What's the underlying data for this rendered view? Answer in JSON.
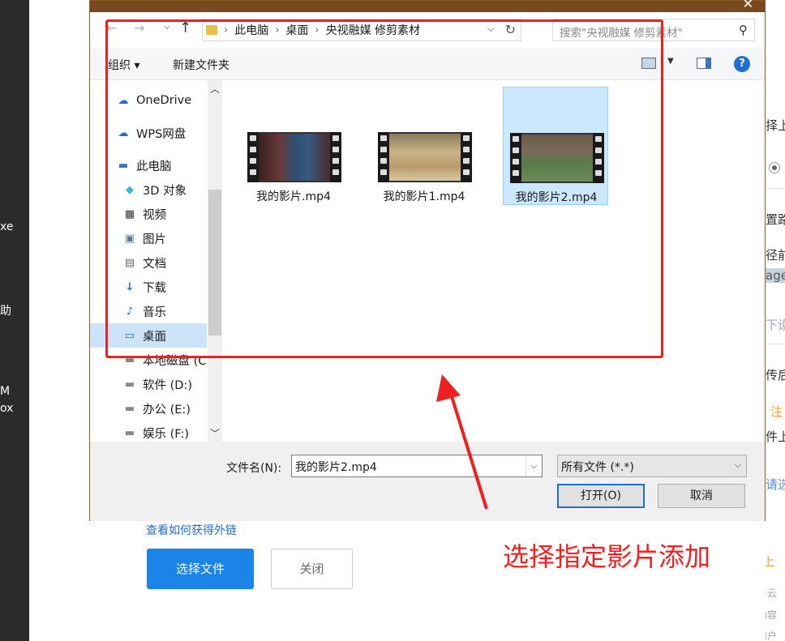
{
  "left_strip": {
    "t1": "xe",
    "t2": "助",
    "t3": "M",
    "t4": "ox"
  },
  "right_bg": {
    "t1": "择上",
    "t2": "置路",
    "t3": "径前",
    "t4": "age/",
    "t5": "下设",
    "t6": "传后",
    "t7": "注",
    "t8": "件上",
    "t9": "请选",
    "t10": "⚠ 上",
    "t11": "七牛云",
    "t12": "权内容",
    "t13": "的用户"
  },
  "dialog": {
    "close": "✕",
    "nav": {
      "back": "←",
      "forward": "→",
      "recent": "⌄",
      "up": "↑"
    },
    "address": {
      "crumbs": [
        "此电脑",
        "桌面",
        "央视融媒 修剪素材"
      ]
    },
    "search_placeholder": "搜索\"央视融媒 修剪素材\"",
    "toolbar": {
      "organize": "组织 ▾",
      "new_folder": "新建文件夹",
      "help": "?"
    },
    "sidebar": [
      {
        "label": "OneDrive",
        "icon": "☁"
      },
      {
        "label": "WPS网盘",
        "icon": "☁"
      },
      {
        "label": "此电脑",
        "icon": "▬"
      },
      {
        "label": "3D 对象",
        "icon": "◆"
      },
      {
        "label": "视频",
        "icon": "▦"
      },
      {
        "label": "图片",
        "icon": "▣"
      },
      {
        "label": "文档",
        "icon": "▤"
      },
      {
        "label": "下载",
        "icon": "↓"
      },
      {
        "label": "音乐",
        "icon": "♪"
      },
      {
        "label": "桌面",
        "icon": "▭"
      },
      {
        "label": "本地磁盘 (C",
        "icon": "▬"
      },
      {
        "label": "软件 (D:)",
        "icon": "▬"
      },
      {
        "label": "办公 (E:)",
        "icon": "▬"
      },
      {
        "label": "娱乐 (F:)",
        "icon": "▬"
      }
    ],
    "files": [
      {
        "name": "我的影片.mp4"
      },
      {
        "name": "我的影片1.mp4"
      },
      {
        "name": "我的影片2.mp4"
      }
    ],
    "filename_label": "文件名(N):",
    "filename_value": "我的影片2.mp4",
    "filetype": "所有文件 (*.*)",
    "open_btn": "打开(O)",
    "cancel_btn": "取消"
  },
  "annotation": "选择指定影片添加",
  "page": {
    "link": "查看如何获得外链",
    "choose_btn": "选择文件",
    "close_btn": "关闭"
  },
  "colors": {
    "accent": "#1a84e8",
    "annotation": "#f02020",
    "selection": "#cce8ff"
  }
}
